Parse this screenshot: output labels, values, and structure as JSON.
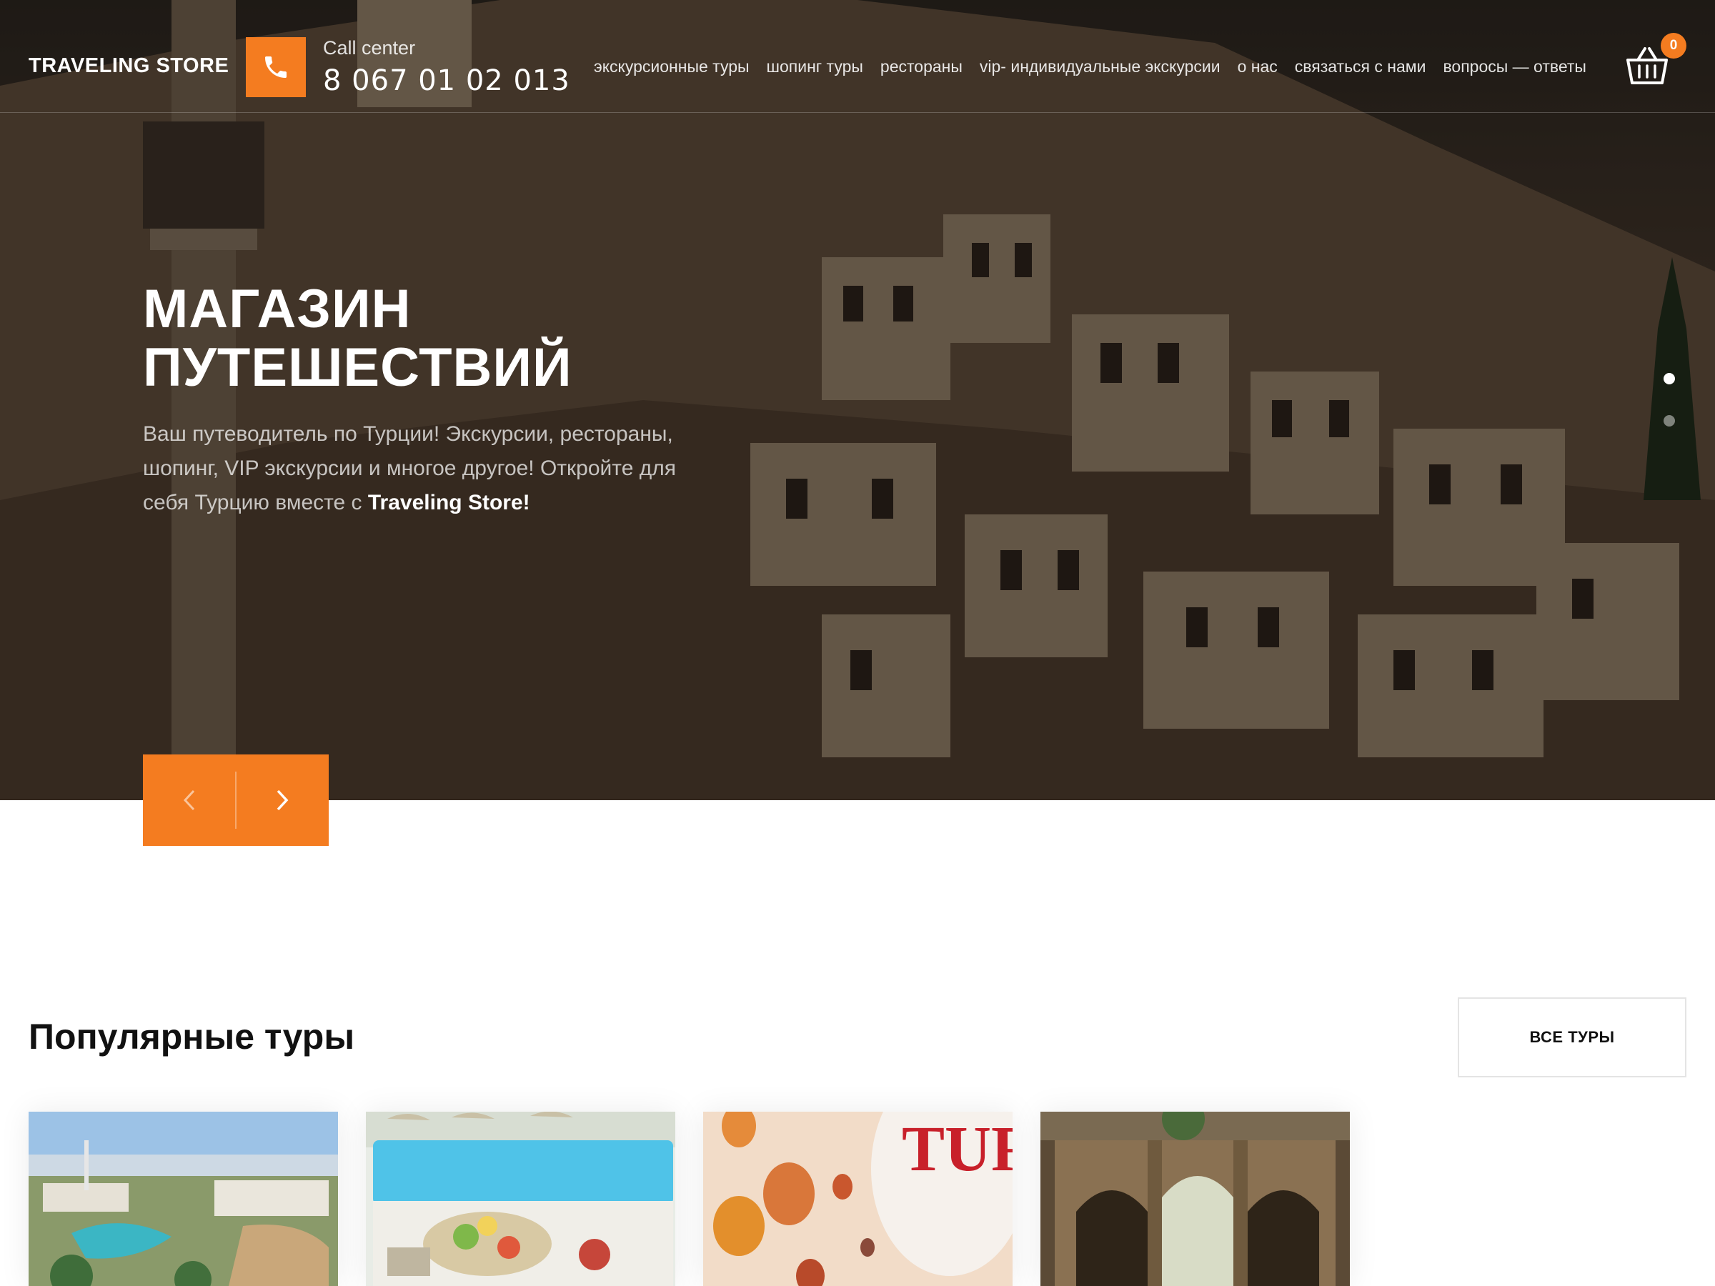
{
  "header": {
    "logo": "TRAVELING STORE",
    "call_label": "Call center",
    "call_number": "8 067 01 02 013",
    "nav": [
      {
        "label": "экскурсионные туры"
      },
      {
        "label": "шопинг туры"
      },
      {
        "label": "рестораны"
      },
      {
        "label": "vip- индивидуальные экскурсии"
      },
      {
        "label": "о нас"
      },
      {
        "label": "связаться с нами"
      },
      {
        "label": "вопросы — ответы"
      }
    ],
    "cart_count": "0"
  },
  "hero": {
    "title_line1": "МАГАЗИН",
    "title_line2": "ПУТЕШЕСТВИЙ",
    "subtitle_plain": "Ваш путеводитель по Турции! Экскурсии, рестораны, шопинг, VIP экскурсии и многое другое! Откройте для себя Турцию вместе с ",
    "subtitle_brand": "Traveling Store!",
    "slides_total": 2,
    "active_slide": 1
  },
  "popular": {
    "title": "Популярные туры",
    "all_button": "ВСЕ ТУРЫ",
    "cards": [
      {
        "icon": "resort-aerial-image"
      },
      {
        "icon": "pool-buffet-image"
      },
      {
        "icon": "hot-air-balloons-image",
        "banner_text": "TUR"
      },
      {
        "icon": "hadrians-gate-image"
      }
    ]
  },
  "colors": {
    "accent": "#f47c20",
    "text_dark": "#111111",
    "white": "#ffffff"
  }
}
